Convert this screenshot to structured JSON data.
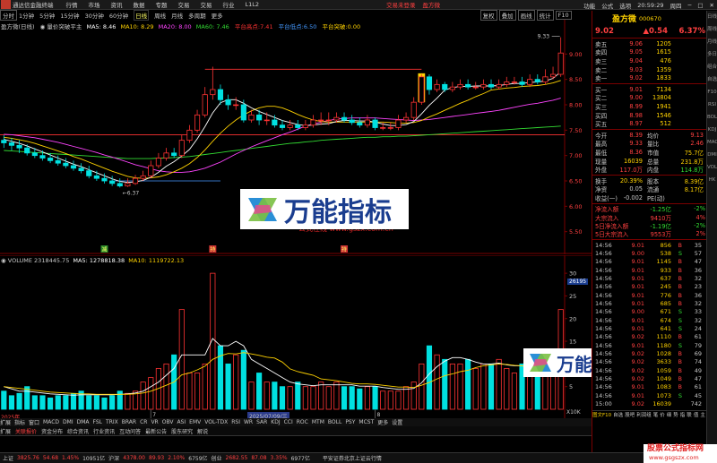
{
  "app": {
    "title": "通达信金融终端",
    "menu": [
      "行情",
      "市场",
      "资讯",
      "数据",
      "专题",
      "交易",
      "交易",
      "行业",
      "L1L2"
    ],
    "center_red": [
      "交易未登录",
      "盈方微"
    ],
    "right_menu": [
      "功能",
      "公式",
      "选项",
      "20:59:29",
      "周四"
    ]
  },
  "period_bar": {
    "items": [
      "分时",
      "1分钟",
      "5分钟",
      "15分钟",
      "30分钟",
      "60分钟",
      "日线",
      "周线",
      "月线",
      "多周期",
      "更多"
    ],
    "selected": "日线",
    "right_buttons": [
      "复权",
      "叠加",
      "画线",
      "统计",
      "F10"
    ]
  },
  "main_chart": {
    "title": "盈方微(日线)",
    "indicator": "量价突破平主",
    "ma": [
      {
        "label": "MA5: 8.46",
        "color": "#ffffff"
      },
      {
        "label": "MA10: 8.29",
        "color": "#ffd200"
      },
      {
        "label": "MA20: 8.00",
        "color": "#ff44ff"
      },
      {
        "label": "MA60: 7.46",
        "color": "#33dd33"
      }
    ],
    "platform_high": {
      "label": "平台高点:",
      "value": "7.41",
      "color": "#ff3333"
    },
    "platform_low": {
      "label": "平台低点:",
      "value": "6.50",
      "color": "#4499ff"
    },
    "breakout": {
      "label": "平台突破:",
      "value": "0.00",
      "color": "#ffd200"
    },
    "high_mark": "9.33",
    "low_mark": "6.37",
    "watermark_site": "公式在线  www.gszx.com.cn",
    "markers": [
      "减",
      "持",
      "持"
    ],
    "price_axis": [
      "9.00",
      "8.50",
      "8.00",
      "7.50",
      "7.00",
      "6.50",
      "6.00",
      "5.50"
    ]
  },
  "volume_chart": {
    "title": "VOLUME",
    "values_text": "2318445.75",
    "ma5": "MA5: 1278818.38",
    "ma10": "MA10: 1119722.13",
    "axis_box": "26195",
    "axis": [
      "30",
      "25",
      "20",
      "15",
      "10",
      "5"
    ],
    "axis_unit": "X10K",
    "year_label": "2025年",
    "date_tooltip": "2025/07/09/三",
    "divider_labels": [
      "7",
      "8"
    ]
  },
  "chart_data": {
    "type": "candlestick",
    "x": [
      "d01",
      "d02",
      "d03",
      "d04",
      "d05",
      "d06",
      "d07",
      "d08",
      "d09",
      "d10",
      "d11",
      "d12",
      "d13",
      "d14",
      "d15",
      "d16",
      "d17",
      "d18",
      "d19",
      "d20",
      "d21",
      "d22",
      "d23",
      "d24",
      "d25",
      "d26",
      "d27",
      "d28",
      "d29",
      "d30",
      "d31",
      "d32",
      "d33",
      "d34",
      "d35",
      "d36",
      "d37",
      "d38",
      "d39",
      "d40",
      "d41",
      "d42",
      "d43",
      "d44",
      "d45",
      "d46",
      "d47",
      "d48",
      "d49",
      "d50",
      "d51",
      "d52",
      "d53",
      "d54",
      "d55",
      "d56",
      "d57",
      "d58",
      "d59",
      "d60",
      "d61",
      "d62",
      "d63",
      "d64",
      "d65",
      "d66",
      "d67",
      "d68",
      "d69",
      "d70",
      "d71",
      "d72",
      "d73"
    ],
    "open": [
      7.3,
      7.25,
      7.2,
      7.15,
      7.05,
      7.0,
      6.95,
      6.9,
      6.85,
      6.8,
      6.75,
      6.7,
      6.6,
      6.55,
      6.5,
      6.45,
      6.4,
      6.45,
      6.55,
      6.6,
      6.8,
      6.95,
      7.05,
      7.0,
      7.3,
      7.5,
      7.8,
      8.2,
      8.3,
      8.1,
      8.0,
      8.0,
      7.7,
      7.8,
      7.7,
      7.7,
      7.6,
      7.55,
      7.6,
      7.55,
      7.6,
      7.7,
      7.7,
      7.7,
      7.75,
      7.7,
      7.65,
      7.6,
      7.7,
      7.55,
      7.55,
      7.55,
      7.7,
      7.75,
      8.05,
      8.55,
      8.3,
      8.4,
      8.3,
      8.35,
      8.4,
      8.35,
      8.35,
      8.4,
      8.35,
      8.4,
      8.45,
      8.45,
      8.4,
      8.5,
      8.45,
      8.55,
      8.6
    ],
    "close": [
      7.25,
      7.2,
      7.15,
      7.05,
      7.0,
      6.95,
      6.9,
      6.85,
      6.8,
      6.75,
      6.7,
      6.6,
      6.55,
      6.5,
      6.45,
      6.4,
      6.45,
      6.55,
      6.6,
      6.8,
      6.95,
      7.05,
      7.0,
      7.3,
      7.5,
      7.8,
      8.2,
      8.3,
      8.1,
      8.0,
      8.0,
      7.7,
      7.8,
      7.7,
      7.7,
      7.6,
      7.55,
      7.6,
      7.55,
      7.6,
      7.7,
      7.7,
      7.7,
      7.75,
      7.7,
      7.65,
      7.6,
      7.7,
      7.55,
      7.55,
      7.55,
      7.7,
      7.75,
      8.05,
      8.55,
      8.3,
      8.4,
      8.3,
      8.35,
      8.4,
      8.35,
      8.35,
      8.4,
      8.35,
      8.4,
      8.45,
      8.45,
      8.4,
      8.5,
      8.45,
      8.55,
      8.6,
      9.02
    ],
    "high": [
      7.4,
      7.35,
      7.3,
      7.22,
      7.15,
      7.1,
      7.05,
      7.0,
      6.95,
      6.9,
      6.85,
      6.8,
      6.7,
      6.65,
      6.6,
      6.55,
      6.55,
      6.62,
      6.7,
      6.9,
      7.05,
      7.15,
      7.15,
      7.4,
      7.6,
      7.9,
      8.35,
      8.75,
      8.4,
      8.2,
      8.15,
      8.1,
      7.9,
      7.9,
      7.85,
      7.8,
      7.7,
      7.7,
      7.7,
      7.7,
      7.8,
      7.85,
      7.85,
      7.85,
      7.85,
      7.8,
      7.75,
      7.8,
      7.75,
      7.65,
      7.65,
      7.8,
      7.85,
      8.15,
      8.6,
      8.6,
      8.5,
      8.45,
      8.45,
      8.5,
      8.5,
      8.45,
      8.5,
      8.5,
      8.5,
      8.55,
      8.55,
      8.55,
      8.6,
      8.6,
      8.7,
      8.75,
      9.33
    ],
    "low": [
      7.15,
      7.1,
      7.05,
      7.0,
      6.95,
      6.9,
      6.85,
      6.8,
      6.75,
      6.7,
      6.65,
      6.55,
      6.5,
      6.45,
      6.4,
      6.37,
      6.38,
      6.42,
      6.5,
      6.55,
      6.75,
      6.9,
      6.95,
      6.95,
      7.25,
      7.45,
      7.75,
      8.1,
      8.0,
      7.9,
      7.9,
      7.65,
      7.65,
      7.6,
      7.6,
      7.55,
      7.5,
      7.5,
      7.5,
      7.5,
      7.55,
      7.6,
      7.6,
      7.65,
      7.65,
      7.6,
      7.55,
      7.55,
      7.5,
      7.5,
      7.5,
      7.5,
      7.65,
      7.7,
      8.0,
      8.2,
      8.25,
      8.25,
      8.25,
      8.3,
      8.3,
      8.3,
      8.3,
      8.3,
      8.3,
      8.35,
      8.4,
      8.35,
      8.35,
      8.4,
      8.4,
      8.5,
      8.55
    ],
    "ma5": [
      7.32,
      7.28,
      7.24,
      7.19,
      7.13,
      7.07,
      7.01,
      6.95,
      6.89,
      6.83,
      6.78,
      6.72,
      6.66,
      6.6,
      6.54,
      6.49,
      6.47,
      6.48,
      6.51,
      6.57,
      6.67,
      6.79,
      6.88,
      6.99,
      7.12,
      7.33,
      7.57,
      7.84,
      8.04,
      8.1,
      8.1,
      8.03,
      7.94,
      7.87,
      7.81,
      7.75,
      7.69,
      7.65,
      7.61,
      7.59,
      7.6,
      7.62,
      7.63,
      7.67,
      7.69,
      7.69,
      7.68,
      7.68,
      7.66,
      7.62,
      7.59,
      7.59,
      7.61,
      7.67,
      7.82,
      7.99,
      8.13,
      8.29,
      8.34,
      8.36,
      8.36,
      8.37,
      8.37,
      8.37,
      8.38,
      8.4,
      8.42,
      8.42,
      8.44,
      8.45,
      8.47,
      8.52,
      8.65
    ],
    "ma10": [
      7.36,
      7.34,
      7.31,
      7.28,
      7.24,
      7.19,
      7.14,
      7.09,
      7.04,
      6.98,
      6.93,
      6.87,
      6.81,
      6.75,
      6.69,
      6.64,
      6.59,
      6.56,
      6.55,
      6.56,
      6.58,
      6.62,
      6.68,
      6.75,
      6.84,
      6.96,
      7.11,
      7.28,
      7.44,
      7.58,
      7.7,
      7.8,
      7.88,
      7.94,
      7.97,
      7.97,
      7.94,
      7.88,
      7.81,
      7.75,
      7.7,
      7.67,
      7.66,
      7.66,
      7.66,
      7.66,
      7.66,
      7.66,
      7.66,
      7.66,
      7.65,
      7.64,
      7.64,
      7.65,
      7.69,
      7.76,
      7.82,
      7.89,
      7.96,
      8.03,
      8.09,
      8.16,
      8.22,
      8.29,
      8.31,
      8.33,
      8.34,
      8.36,
      8.37,
      8.38,
      8.4,
      8.43,
      8.48
    ],
    "ma20": [
      7.42,
      7.41,
      7.39,
      7.37,
      7.35,
      7.32,
      7.29,
      7.26,
      7.22,
      7.18,
      7.14,
      7.1,
      7.06,
      7.01,
      6.97,
      6.92,
      6.87,
      6.82,
      6.78,
      6.74,
      6.7,
      6.68,
      6.67,
      6.67,
      6.68,
      6.71,
      6.75,
      6.81,
      6.87,
      6.95,
      7.03,
      7.1,
      7.17,
      7.23,
      7.29,
      7.35,
      7.41,
      7.46,
      7.52,
      7.58,
      7.62,
      7.66,
      7.69,
      7.72,
      7.73,
      7.74,
      7.74,
      7.74,
      7.74,
      7.73,
      7.72,
      7.71,
      7.7,
      7.69,
      7.7,
      7.71,
      7.73,
      7.75,
      7.77,
      7.79,
      7.81,
      7.83,
      7.85,
      7.87,
      7.89,
      7.92,
      7.95,
      7.98,
      8.01,
      8.03,
      8.06,
      8.09,
      8.13
    ],
    "ma60": [
      7.1,
      7.09,
      7.08,
      7.07,
      7.06,
      7.05,
      7.04,
      7.03,
      7.02,
      7.01,
      7.0,
      6.99,
      6.98,
      6.97,
      6.96,
      6.95,
      6.94,
      6.94,
      6.94,
      6.94,
      6.95,
      6.95,
      6.96,
      6.97,
      6.98,
      7.0,
      7.02,
      7.04,
      7.06,
      7.08,
      7.1,
      7.12,
      7.14,
      7.16,
      7.18,
      7.2,
      7.22,
      7.24,
      7.25,
      7.27,
      7.28,
      7.3,
      7.31,
      7.32,
      7.33,
      7.34,
      7.35,
      7.36,
      7.36,
      7.37,
      7.37,
      7.38,
      7.38,
      7.39,
      7.4,
      7.41,
      7.42,
      7.43,
      7.44,
      7.45,
      7.46,
      7.47,
      7.48,
      7.49,
      7.5,
      7.51,
      7.52,
      7.53,
      7.54,
      7.55,
      7.56,
      7.57,
      7.58
    ],
    "volume": [
      4,
      3,
      3.5,
      5,
      3,
      3,
      2.5,
      3,
      3,
      3.5,
      4,
      3,
      3,
      2.5,
      3,
      4,
      3.5,
      4,
      6,
      7,
      9,
      10,
      12,
      22,
      8,
      8,
      10,
      30,
      14,
      10,
      12,
      13,
      6,
      8,
      6,
      6,
      5,
      5,
      6,
      5,
      5,
      6,
      5,
      6,
      5,
      5,
      4.5,
      5,
      5,
      4,
      4,
      4,
      5,
      6,
      10,
      14,
      12,
      11,
      10,
      10,
      11,
      9,
      10,
      10,
      11,
      9,
      8,
      10,
      8,
      9,
      10,
      12,
      22
    ],
    "vol_ma5": [
      5,
      4.5,
      4,
      4,
      3.8,
      3.6,
      3.4,
      3.3,
      3.2,
      3.1,
      3.2,
      3.2,
      3.2,
      3.2,
      3.2,
      3.3,
      3.4,
      3.6,
      4,
      5,
      6,
      7.5,
      9,
      12,
      12,
      12,
      12,
      15.6,
      14,
      14,
      15,
      14,
      11,
      10,
      9,
      8,
      7,
      6,
      5.6,
      5.4,
      5.2,
      5.4,
      5.4,
      5.4,
      5.4,
      5.4,
      5.1,
      5.1,
      5.1,
      4.8,
      4.6,
      4.4,
      4.4,
      4.6,
      5.8,
      7.8,
      9.4,
      10.6,
      11.4,
      11.4,
      11,
      10.4,
      10,
      10,
      10.2,
      9.8,
      9.6,
      9.6,
      9.2,
      9.2,
      9,
      9.8,
      12.2
    ],
    "vol_ma10": [
      5,
      4.8,
      4.6,
      4.4,
      4.2,
      4,
      3.8,
      3.7,
      3.6,
      3.5,
      3.4,
      3.4,
      3.3,
      3.3,
      3.3,
      3.3,
      3.3,
      3.4,
      3.6,
      4,
      4.6,
      5.3,
      6,
      7.6,
      8,
      8.7,
      9.5,
      11,
      11.8,
      12.3,
      12.2,
      12.5,
      12.2,
      11.9,
      11.5,
      11.3,
      10.4,
      8.9,
      8.3,
      7.9,
      7.5,
      6.7,
      6.5,
      6.3,
      6,
      5.7,
      5.6,
      5.6,
      5.5,
      5.3,
      5.1,
      4.9,
      4.9,
      4.8,
      5.3,
      5.9,
      6.7,
      7.4,
      7.8,
      8.3,
      8.6,
      9.2,
      9.6,
      9.8,
      10,
      9.9,
      9.7,
      9.6,
      9.5,
      9.3,
      9.2,
      9.6,
      10.8
    ],
    "ylim": [
      5.3,
      9.5
    ],
    "vol_ylim": [
      0,
      32
    ],
    "platform_high_value": 7.41,
    "platform_low_value": 6.5,
    "breakout_index": 54
  },
  "quote": {
    "name": "盈方微",
    "code": "000670",
    "price": "9.02",
    "change": "▲0.54",
    "pct": "6.37%"
  },
  "order_book": {
    "asks": [
      {
        "label": "卖五",
        "price": "9.06",
        "vol": "1205"
      },
      {
        "label": "卖四",
        "price": "9.05",
        "vol": "1615"
      },
      {
        "label": "卖三",
        "price": "9.04",
        "vol": "476"
      },
      {
        "label": "卖二",
        "price": "9.03",
        "vol": "1359"
      },
      {
        "label": "卖一",
        "price": "9.02",
        "vol": "1833"
      }
    ],
    "bids": [
      {
        "label": "买一",
        "price": "9.01",
        "vol": "7134"
      },
      {
        "label": "买二",
        "price": "9.00",
        "vol": "13804"
      },
      {
        "label": "买三",
        "price": "8.99",
        "vol": "1941"
      },
      {
        "label": "买四",
        "price": "8.98",
        "vol": "1546"
      },
      {
        "label": "买五",
        "price": "8.97",
        "vol": "512"
      }
    ]
  },
  "stats": [
    {
      "a": "今开",
      "b": "8.39",
      "bc": "#ff4040",
      "c": "均价",
      "d": "9.13",
      "dc": "#ff4040"
    },
    {
      "a": "最高",
      "b": "9.33",
      "bc": "#ff4040",
      "c": "量比",
      "d": "2.46",
      "dc": "#ff4040"
    },
    {
      "a": "最低",
      "b": "8.36",
      "bc": "#ff4040",
      "c": "市值",
      "d": "75.7亿",
      "dc": "#ffd200"
    },
    {
      "a": "现量",
      "b": "16039",
      "bc": "#ffd200",
      "c": "总量",
      "d": "231.8万",
      "dc": "#ffd200"
    },
    {
      "a": "外盘",
      "b": "117.0万",
      "bc": "#ff4040",
      "c": "内盘",
      "d": "114.8万",
      "dc": "#33dd33"
    },
    {
      "a": "换手",
      "b": "20.39%",
      "bc": "#ffd200",
      "c": "股本",
      "d": "8.39亿",
      "dc": "#ffd200"
    },
    {
      "a": "净资",
      "b": "0.05",
      "bc": "#c8c8c8",
      "c": "流通",
      "d": "8.17亿",
      "dc": "#ffd200"
    },
    {
      "a": "收益(一)",
      "b": "-0.002",
      "bc": "#c8c8c8",
      "c": "PE(动)",
      "d": "",
      "dc": "#c8c8c8"
    }
  ],
  "flows": [
    {
      "a": "净流入额",
      "ac": "#ff4040",
      "b": "-1.25亿",
      "c": "-2%"
    },
    {
      "a": "大宗流入",
      "ac": "#ff4040",
      "b": "9410万",
      "c": "4%"
    },
    {
      "a": "5日净流入额",
      "ac": "#ff4040",
      "b": "-1.19亿",
      "c": "-2%"
    },
    {
      "a": "5日大宗流入",
      "ac": "#ff4040",
      "b": "9553万",
      "c": "2%"
    }
  ],
  "ticks": [
    {
      "t": "14:56",
      "p": "9.01",
      "v": "856",
      "s": "B",
      "n": "35"
    },
    {
      "t": "14:56",
      "p": "9.00",
      "v": "538",
      "s": "S",
      "n": "57"
    },
    {
      "t": "14:56",
      "p": "9.01",
      "v": "1145",
      "s": "B",
      "n": "47"
    },
    {
      "t": "14:56",
      "p": "9.01",
      "v": "933",
      "s": "B",
      "n": "36"
    },
    {
      "t": "14:56",
      "p": "9.01",
      "v": "637",
      "s": "B",
      "n": "32"
    },
    {
      "t": "14:56",
      "p": "9.01",
      "v": "245",
      "s": "B",
      "n": "23"
    },
    {
      "t": "14:56",
      "p": "9.01",
      "v": "776",
      "s": "B",
      "n": "36"
    },
    {
      "t": "14:56",
      "p": "9.01",
      "v": "685",
      "s": "B",
      "n": "32"
    },
    {
      "t": "14:56",
      "p": "9.00",
      "v": "671",
      "s": "S",
      "n": "33"
    },
    {
      "t": "14:56",
      "p": "9.01",
      "v": "674",
      "s": "S",
      "n": "32"
    },
    {
      "t": "14:56",
      "p": "9.01",
      "v": "641",
      "s": "S",
      "n": "24"
    },
    {
      "t": "14:56",
      "p": "9.02",
      "v": "1110",
      "s": "B",
      "n": "61"
    },
    {
      "t": "14:56",
      "p": "9.01",
      "v": "1180",
      "s": "S",
      "n": "79"
    },
    {
      "t": "14:56",
      "p": "9.02",
      "v": "1028",
      "s": "B",
      "n": "69"
    },
    {
      "t": "14:56",
      "p": "9.02",
      "v": "3633",
      "s": "B",
      "n": "74"
    },
    {
      "t": "14:56",
      "p": "9.02",
      "v": "1059",
      "s": "B",
      "n": "49"
    },
    {
      "t": "14:56",
      "p": "9.02",
      "v": "1049",
      "s": "B",
      "n": "47"
    },
    {
      "t": "14:56",
      "p": "9.01",
      "v": "1083",
      "s": "B",
      "n": "61"
    },
    {
      "t": "14:56",
      "p": "9.01",
      "v": "1073",
      "s": "S",
      "n": "45"
    },
    {
      "t": "15:00",
      "p": "9.02",
      "v": "16039",
      "s": "",
      "n": "742"
    }
  ],
  "right_tabs": [
    "图文F10",
    "自选",
    "股吧",
    "利润组",
    "笔",
    "价",
    "细",
    "势",
    "指",
    "联",
    "值",
    "主"
  ],
  "bottom_tabs": [
    "扩展",
    "指标",
    "窗口",
    "MACD",
    "DMI",
    "DMA",
    "FSL",
    "TRIX",
    "BRAR",
    "CR",
    "VR",
    "OBV",
    "ASI",
    "EMV",
    "VOL-TDX",
    "RSI",
    "WR",
    "SAR",
    "KDJ",
    "CCI",
    "ROC",
    "MTM",
    "BOLL",
    "PSY",
    "MCST",
    "更多",
    "设置"
  ],
  "bottom_tabs2": [
    "扩展",
    "关联报价",
    "资金分布",
    "综合资讯",
    "行业资讯",
    "互动问答",
    "最新公告",
    "股东研究",
    "解说"
  ],
  "sidebar": [
    "日线",
    "周线",
    "月线",
    "多日",
    "组合",
    "自选",
    "F10",
    "RSI",
    "BOLL",
    "KDJ",
    "MACD",
    "DMI",
    "VOL",
    "HK"
  ],
  "status_bar": [
    {
      "text": "上证",
      "color": "#c8c8c8"
    },
    {
      "text": "3825.76",
      "color": "#ff4040"
    },
    {
      "text": "54.68",
      "color": "#ff4040"
    },
    {
      "text": "1.45%",
      "color": "#ff4040"
    },
    {
      "text": "10951亿",
      "color": "#c8c8c8"
    },
    {
      "text": "沪深",
      "color": "#c8c8c8"
    },
    {
      "text": "4378.00",
      "color": "#ff4040"
    },
    {
      "text": "89.93",
      "color": "#ff4040"
    },
    {
      "text": "2.10%",
      "color": "#ff4040"
    },
    {
      "text": "6759亿",
      "color": "#c8c8c8"
    },
    {
      "text": "创业",
      "color": "#c8c8c8"
    },
    {
      "text": "2682.55",
      "color": "#ff4040"
    },
    {
      "text": "87.08",
      "color": "#ff4040"
    },
    {
      "text": "3.35%",
      "color": "#ff4040"
    },
    {
      "text": "6977亿",
      "color": "#c8c8c8"
    },
    {
      "text": "平安证券北京上证云行情",
      "color": "#c8c8c8"
    }
  ],
  "watermark_brand": "万能指标",
  "brand_tag": {
    "line1": "股票公式指标网",
    "line2": "www.gsgszx.com"
  }
}
